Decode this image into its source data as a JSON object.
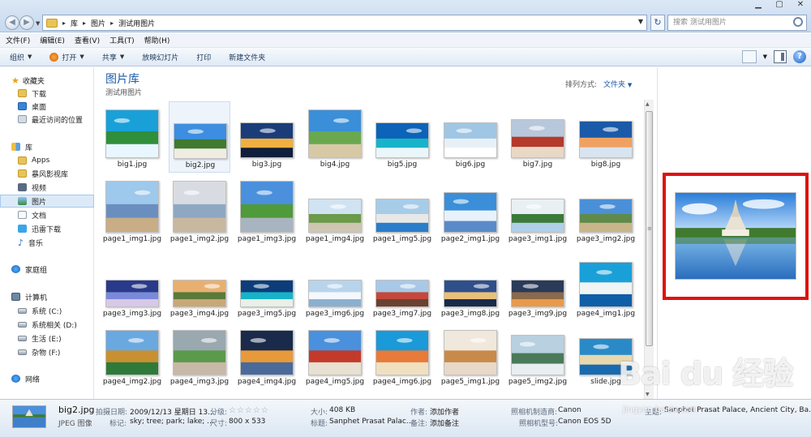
{
  "address": {
    "crumbs": [
      "库",
      "图片",
      "测试用图片"
    ],
    "search_placeholder": "搜索 测试用图片"
  },
  "menu": [
    "文件(F)",
    "编辑(E)",
    "查看(V)",
    "工具(T)",
    "帮助(H)"
  ],
  "toolbar": {
    "organize": "组织",
    "open": "打开",
    "share": "共享",
    "slideshow": "放映幻灯片",
    "print": "打印",
    "new_folder": "新建文件夹"
  },
  "sidebar": {
    "favorites": "收藏夹",
    "downloads": "下载",
    "desktop": "桌面",
    "recent": "最近访问的位置",
    "libraries": "库",
    "apps": "Apps",
    "storm": "暴风影视库",
    "videos": "视频",
    "pictures": "图片",
    "documents": "文档",
    "thunder": "迅雷下载",
    "music": "音乐",
    "homegroup": "家庭组",
    "computer": "计算机",
    "drive_c": "系统 (C:)",
    "drive_d": "系统相关 (D:)",
    "drive_e": "生活 (E:)",
    "drive_f": "杂物 (F:)",
    "network": "网络"
  },
  "main": {
    "library_title": "图片库",
    "library_subtitle": "测试用图片",
    "arrange_label": "排列方式:",
    "arrange_value": "文件夹",
    "files": [
      "big1.jpg",
      "big2.jpg",
      "big3.jpg",
      "big4.jpg",
      "big5.jpg",
      "big6.jpg",
      "big7.jpg",
      "big8.jpg",
      "page1_img1.jpg",
      "page1_img2.jpg",
      "page1_img3.jpg",
      "page1_img4.jpg",
      "page1_img5.jpg",
      "page2_img1.jpg",
      "page3_img1.jpg",
      "page3_img2.jpg",
      "page3_img3.jpg",
      "page3_img4.jpg",
      "page3_img5.jpg",
      "page3_img6.jpg",
      "page3_img7.jpg",
      "page3_img8.jpg",
      "page3_img9.jpg",
      "page4_img1.jpg",
      "page4_img2.jpg",
      "page4_img3.jpg",
      "page4_img4.jpg",
      "page4_img5.jpg",
      "page4_img6.jpg",
      "page5_img1.jpg",
      "page5_img2.jpg",
      "slide.jpg"
    ],
    "selected_file": "big2.jpg"
  },
  "details": {
    "name": "big2.jpg",
    "type": "JPEG 图像",
    "date_label": "拍摄日期:",
    "date_value": "2009/12/13 星期日 13...",
    "rating_label": "分级:",
    "tags_label": "标记:",
    "tags_value": "sky; tree; park; lake; ...",
    "size_dim_label": "尺寸:",
    "size_dim_value": "800 x 533",
    "filesize_label": "大小:",
    "filesize_value": "408 KB",
    "title_label": "标题:",
    "title_value": "Sanphet Prasat Palac...",
    "author_label": "作者:",
    "author_value": "添加作者",
    "notes_label": "备注:",
    "notes_value": "添加备注",
    "maker_label": "照相机制造商:",
    "maker_value": "Canon",
    "model_label": "照相机型号:",
    "model_value": "Canon EOS 5D",
    "subject_label": "主题:",
    "subject_value": "Sanphet Prasat Palace, Ancient City, Ba..."
  },
  "watermark": {
    "logo": "Bai du 经验",
    "url": "jingyan.baidu.com"
  },
  "colors": {
    "accent": "#1e5ba8",
    "highlight": "#e01010"
  }
}
